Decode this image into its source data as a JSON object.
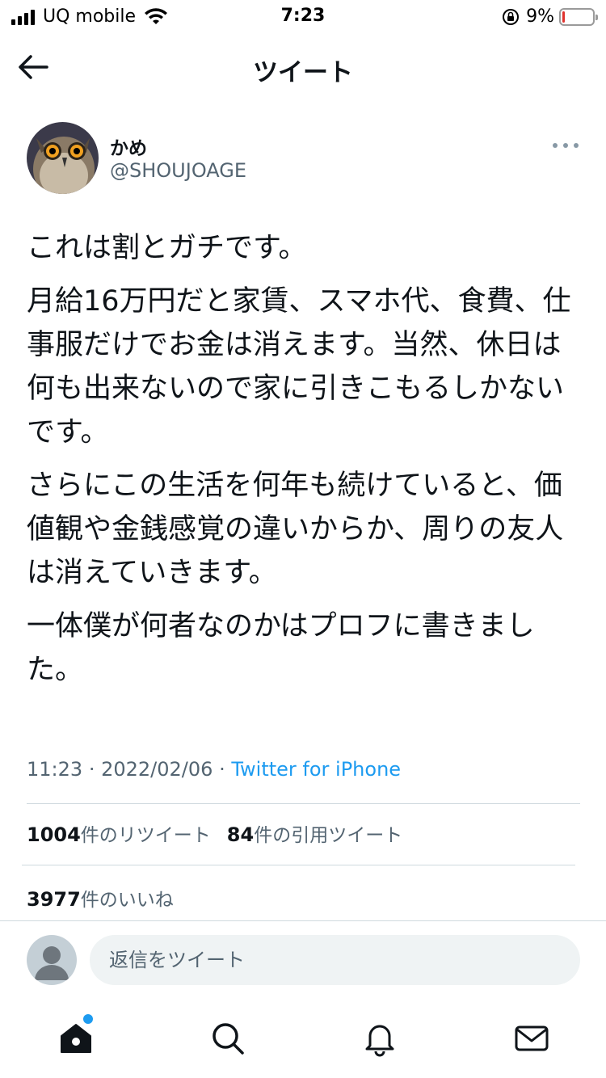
{
  "status_bar": {
    "carrier": "UQ mobile",
    "time": "7:23",
    "battery_percent": "9%",
    "battery_level": 0.09,
    "battery_color": "#e0332e"
  },
  "nav": {
    "title": "ツイート",
    "back_icon": "back-arrow-icon"
  },
  "tweet": {
    "display_name": "かめ",
    "handle": "@SHOUJOAGE",
    "more_icon": "more-horizontal-icon",
    "paragraphs": [
      "これは割とガチです。",
      "月給16万円だと家賃、スマホ代、食費、仕事服だけでお金は消えます。当然、休日は何も出来ないので家に引きこもるしかないです。",
      "さらにこの生活を何年も続けていると、価値観や金銭感覚の違いからか、周りの友人は消えていきます。",
      "一体僕が何者なのかはプロフに書きました。"
    ],
    "time": "11:23",
    "separator": "·",
    "date": "2022/02/06",
    "source": "Twitter for iPhone",
    "source_color": "#1d9bf0",
    "stats": {
      "retweets_count": "1004",
      "retweets_label": "件のリツイート",
      "quotes_count": "84",
      "quotes_label": "件の引用ツイート",
      "likes_count": "3977",
      "likes_label": "件のいいね"
    }
  },
  "reply": {
    "placeholder": "返信をツイート"
  },
  "tab_bar": {
    "items": [
      "home-icon",
      "search-icon",
      "notifications-icon",
      "messages-icon"
    ],
    "accent_color": "#1d9bf0"
  }
}
